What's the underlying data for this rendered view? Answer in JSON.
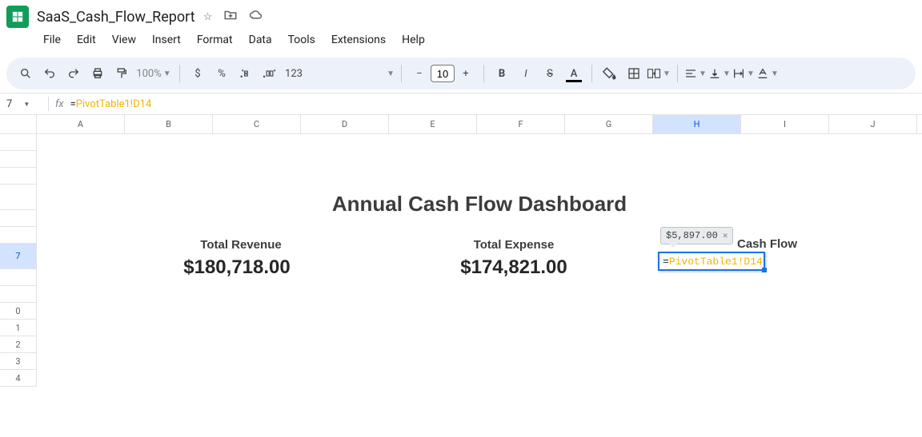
{
  "doc": {
    "title": "SaaS_Cash_Flow_Report"
  },
  "menu": {
    "file": "File",
    "edit": "Edit",
    "view": "View",
    "insert": "Insert",
    "format": "Format",
    "data": "Data",
    "tools": "Tools",
    "extensions": "Extensions",
    "help": "Help"
  },
  "toolbar": {
    "zoom": "100%",
    "fmt_dollar": "$",
    "fmt_percent": "%",
    "fmt_123": "123",
    "font_size": "10",
    "bold": "B",
    "italic": "I",
    "text_color": "A"
  },
  "fx": {
    "cell_name": "7",
    "symbol": "fx",
    "formula_prefix": "=",
    "formula_ref": "PivotTable1!D14"
  },
  "columns": [
    "A",
    "B",
    "C",
    "D",
    "E",
    "F",
    "G",
    "H",
    "I",
    "J"
  ],
  "active_column": "H",
  "rows": [
    "",
    "",
    "",
    "",
    "",
    "",
    "7",
    "",
    "",
    "0",
    "1",
    "2",
    "3",
    "4"
  ],
  "active_row_index": 6,
  "content": {
    "dashboard_title": "Annual Cash Flow Dashboard",
    "revenue_label": "Total Revenue",
    "revenue_value": "$180,718.00",
    "expense_label": "Total Expense",
    "expense_value": "$174,821.00",
    "cashflow_label": "Cash Flow",
    "preview_value": "$5,897.00",
    "editor_prefix": "=",
    "editor_ref": "PivotTable1!D14"
  },
  "chart_data": {
    "type": "table",
    "title": "Annual Cash Flow Dashboard",
    "series": [
      {
        "name": "Total Revenue",
        "values": [
          180718.0
        ]
      },
      {
        "name": "Total Expense",
        "values": [
          174821.0
        ]
      },
      {
        "name": "Cash Flow",
        "values": [
          5897.0
        ]
      }
    ]
  }
}
